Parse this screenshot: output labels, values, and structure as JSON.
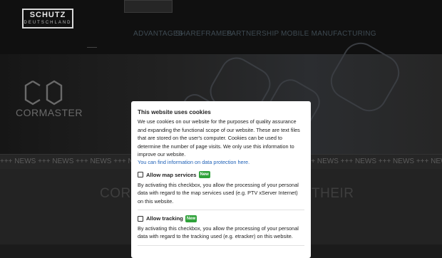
{
  "header": {
    "logo": {
      "line1": "SCHUTZ",
      "line2": "DEUTSCHLAND"
    },
    "top_nav": [
      "",
      "",
      "",
      ""
    ],
    "main_nav": [
      "ADVANTAGES",
      "SHAREFRAMES",
      "PARTNERSHIP",
      "MOBILE MANUFACTURING"
    ]
  },
  "hero": {
    "brand": "CORMASTER"
  },
  "ticker": {
    "text": "+++ NEWS +++ NEWS +++ NEWS +++ NEWS +++ NEWS +++ NEWS +++ NEWS +++ NEWS +++ NEWS +++ NEWS +++ NEWS +++ NEWS +++ NEWS +++ NEWS +++ NEWS +++ NEWS +++ NEWS"
  },
  "content": {
    "title_left": "CORM",
    "title_right": "THEIR"
  },
  "cookie_modal": {
    "title": "This website uses cookies",
    "body": "We use cookies on our website for the purposes of quality assurance and expanding the functional scope of our website. These are text files that are stored on the user's computer. Cookies can be used to determine the number of page visits. We only use this information to improve our website.",
    "link": "You can find information on data protection here.",
    "options": [
      {
        "label": "Allow map services",
        "badge": "New",
        "description": "By activating this checkbox, you allow the processing of your personal data with regard to the map services used (e.g. PTV xServer Internet) on this website."
      },
      {
        "label": "Allow tracking",
        "badge": "New",
        "description": "By activating this checkbox, you allow the processing of your personal data with regard to the tracking used (e.g. etracker) on this website."
      }
    ]
  }
}
